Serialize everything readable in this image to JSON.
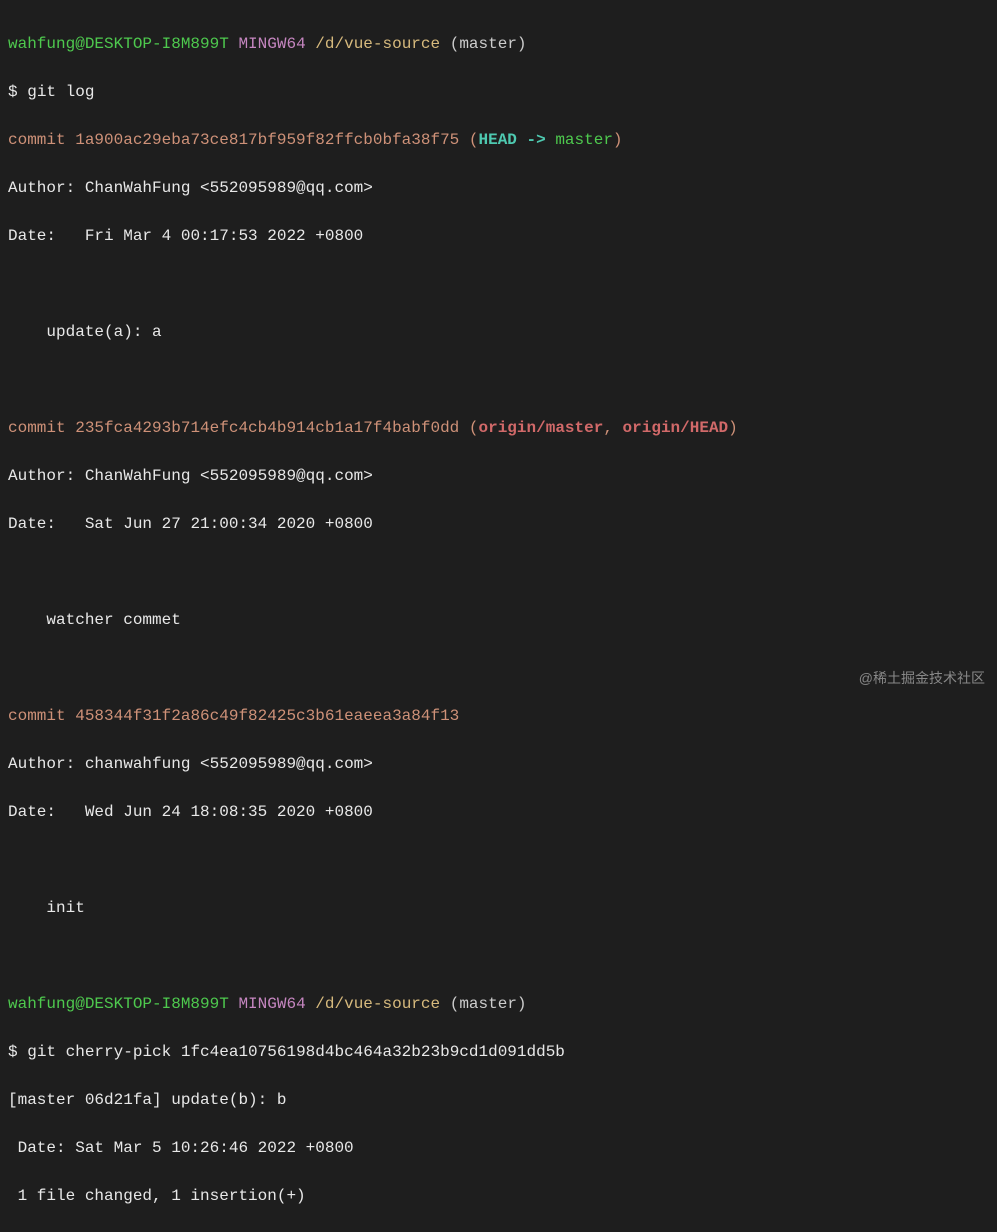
{
  "prompt1": {
    "user_host": "wahfung@DESKTOP-I8M899T",
    "shell": "MINGW64",
    "path": "/d/vue-source",
    "branch": "(master)",
    "symbol": "$",
    "command": "git log"
  },
  "commits": [
    {
      "label": "commit",
      "hash": "1a900ac29eba73ce817bf959f82ffcb0bfa38f75",
      "refs_open": "(",
      "head_arrow": "HEAD -> ",
      "head_branch": "master",
      "refs_close": ")",
      "author_label": "Author:",
      "author": " ChanWahFung <552095989@qq.com>",
      "date_label": "Date:",
      "date": "   Fri Mar 4 00:17:53 2022 +0800",
      "message": "    update(a): a"
    },
    {
      "label": "commit",
      "hash": "235fca4293b714efc4cb4b914cb1a17f4babf0dd",
      "refs_open": "(",
      "remote_refs": "origin/master",
      "refs_sep": ", ",
      "remote_refs2": "origin/HEAD",
      "refs_close": ")",
      "author_label": "Author:",
      "author": " ChanWahFung <552095989@qq.com>",
      "date_label": "Date:",
      "date": "   Sat Jun 27 21:00:34 2020 +0800",
      "message": "    watcher commet"
    },
    {
      "label": "commit",
      "hash": "458344f31f2a86c49f82425c3b61eaeea3a84f13",
      "author_label": "Author:",
      "author": " chanwahfung <552095989@qq.com>",
      "date_label": "Date:",
      "date": "   Wed Jun 24 18:08:35 2020 +0800",
      "message": "    init"
    }
  ],
  "prompt2": {
    "user_host": "wahfung@DESKTOP-I8M899T",
    "shell": "MINGW64",
    "path": "/d/vue-source",
    "branch": "(master)",
    "symbol": "$",
    "command": "git cherry-pick 1fc4ea10756198d4bc464a32b23b9cd1d091dd5b"
  },
  "cherry_result": {
    "line1": "[master 06d21fa] update(b): b",
    "line2": " Date: Sat Mar 5 10:26:46 2022 +0800",
    "line3": " 1 file changed, 1 insertion(+)"
  },
  "watermark": "@稀土掘金技术社区"
}
